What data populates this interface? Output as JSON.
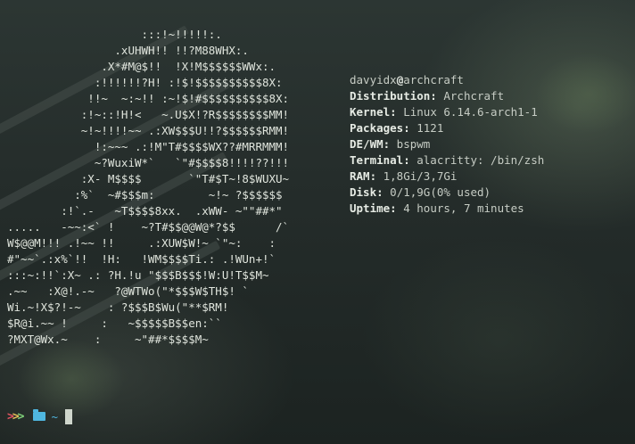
{
  "ascii_art": [
    "                    :::!~!!!!!:.",
    "                .xUHWH!! !!?M88WHX:.",
    "              .X*#M@$!!  !X!M$$$$$$WWx:.",
    "             :!!!!!!?H! :!$!$$$$$$$$$$8X:",
    "            !!~  ~:~!! :~!$!#$$$$$$$$$$8X:",
    "           :!~::!H!<   ~.U$X!?R$$$$$$$$MM!",
    "           ~!~!!!!~~ .:XW$$$U!!?$$$$$$RMM!",
    "             !:~~~ .:!M\"T#$$$$WX??#MRRMMM!",
    "             ~?WuxiW*`   `\"#$$$$8!!!!??!!!",
    "           :X- M$$$$       `\"T#$T~!8$WUXU~",
    "          :%`  ~#$$$m:        ~!~ ?$$$$$$",
    "        :!`.-   ~T$$$$8xx.  .xWW- ~\"\"##*\"",
    ".....   -~~:<` !    ~?T#$$@@W@*?$$      /`",
    "W$@@M!!! .!~~ !!     .:XUW$W!~ `\"~:    :",
    "#\"~~`.:x%`!!  !H:   !WM$$$$Ti.: .!WUn+!`",
    ":::~:!!`:X~ .: ?H.!u \"$$$B$$$!W:U!T$$M~",
    ".~~   :X@!.-~   ?@WTWo(\"*$$$W$TH$! `",
    "Wi.~!X$?!-~    : ?$$$B$Wu(\"**$RM!",
    "$R@i.~~ !     :   ~$$$$$B$$en:``",
    "?MXT@Wx.~    :     ~\"##*$$$$M~"
  ],
  "user_line": {
    "user": "davyidx",
    "at": "@",
    "host": "archcraft"
  },
  "info": [
    {
      "key": "Distribution:",
      "value": " Archcraft"
    },
    {
      "key": "Kernel:",
      "value": " Linux 6.14.6-arch1-1"
    },
    {
      "key": "Packages:",
      "value": " 1121"
    },
    {
      "key": "DE/WM:",
      "value": " bspwm"
    },
    {
      "key": "Terminal:",
      "value": " alacritty: /bin/zsh"
    },
    {
      "key": "RAM:",
      "value": " 1,8Gi/3,7Gi"
    },
    {
      "key": "Disk:",
      "value": " 0/1,9G(0% used)"
    },
    {
      "key": "Uptime:",
      "value": " 4 hours, 7 minutes"
    }
  ],
  "prompt": {
    "arrows": [
      ">",
      ">",
      ">"
    ],
    "arrow_colors": [
      "#e05561",
      "#e6c15a",
      "#7fd07a"
    ],
    "folder_icon": "folder-icon",
    "cwd": "~"
  }
}
